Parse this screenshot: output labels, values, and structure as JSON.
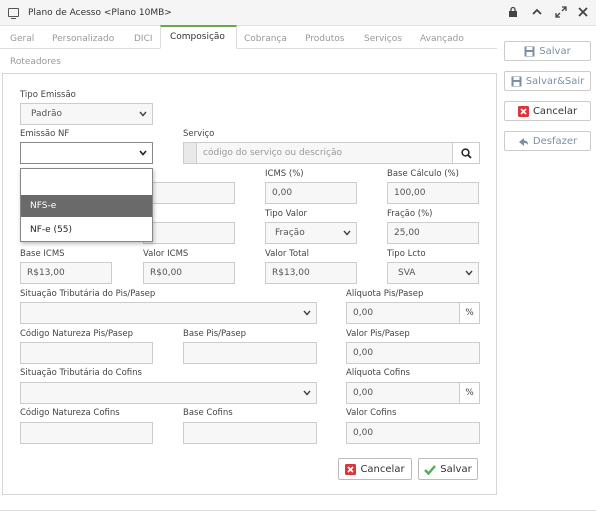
{
  "window": {
    "title": "Plano de Acesso <Plano 10MB>"
  },
  "tabs": [
    {
      "label": "Geral"
    },
    {
      "label": "Personalizado"
    },
    {
      "label": "DICI"
    },
    {
      "label": "Composição"
    },
    {
      "label": "Cobrança"
    },
    {
      "label": "Produtos"
    },
    {
      "label": "Serviços"
    },
    {
      "label": "Avançado"
    },
    {
      "label": "Roteadores"
    }
  ],
  "side_buttons": {
    "save": "Salvar",
    "save_exit": "Salvar&Sair",
    "cancel": "Cancelar",
    "undo": "Desfazer"
  },
  "form": {
    "tipo_emissao": {
      "label": "Tipo Emissão",
      "value": "Padrão"
    },
    "emissao_nf": {
      "label": "Emissão NF",
      "value": "",
      "options": [
        "",
        "NFS-e",
        "NF-e (55)"
      ],
      "highlighted": "NFS-e"
    },
    "servico": {
      "label": "Serviço",
      "placeholder": "código do serviço ou descrição"
    },
    "icms_pct": {
      "label": "ICMS (%)",
      "value": "0,00"
    },
    "base_calculo": {
      "label": "Base Cálculo (%)",
      "value": "100,00"
    },
    "tipo_valor": {
      "label": "Tipo Valor",
      "value": "Fração"
    },
    "fracao": {
      "label": "Fração (%)",
      "value": "25,00"
    },
    "base_icms": {
      "label": "Base ICMS",
      "value": "R$13,00"
    },
    "valor_icms": {
      "label": "Valor ICMS",
      "value": "R$0,00"
    },
    "valor_total": {
      "label": "Valor Total",
      "value": "R$13,00"
    },
    "tipo_lcto": {
      "label": "Tipo Lcto",
      "value": "SVA"
    },
    "sit_trib_pis": {
      "label": "Situação Tributária do Pis/Pasep",
      "value": ""
    },
    "aliq_pis": {
      "label": "Alíquota Pis/Pasep",
      "value": "0,00",
      "unit": "%"
    },
    "cod_nat_pis": {
      "label": "Código Natureza Pis/Pasep",
      "value": ""
    },
    "base_pis": {
      "label": "Base Pis/Pasep",
      "value": ""
    },
    "valor_pis": {
      "label": "Valor Pis/Pasep",
      "value": "0,00"
    },
    "sit_trib_cofins": {
      "label": "Situação Tributária do Cofins",
      "value": ""
    },
    "aliq_cofins": {
      "label": "Alíquota Cofins",
      "value": "0,00",
      "unit": "%"
    },
    "cod_nat_cofins": {
      "label": "Código Natureza Cofins",
      "value": ""
    },
    "base_cofins": {
      "label": "Base Cofins",
      "value": ""
    },
    "valor_cofins": {
      "label": "Valor Cofins",
      "value": "0,00"
    }
  },
  "bottom_buttons": {
    "cancel": "Cancelar",
    "save": "Salvar"
  },
  "colors": {
    "accent": "#6aa84f",
    "cancel_red": "#d9363e",
    "save_green": "#4caf50",
    "selected_option": "#6a6a6a"
  }
}
